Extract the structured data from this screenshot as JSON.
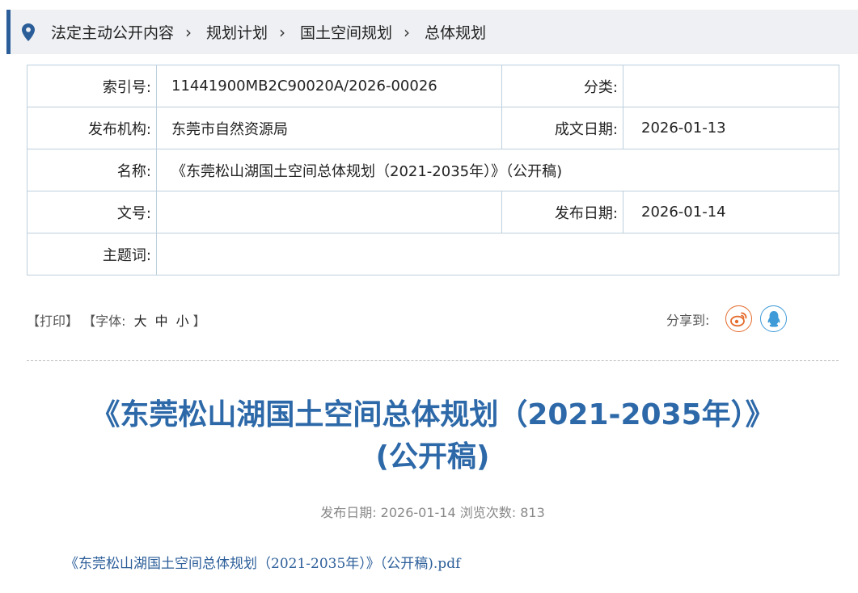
{
  "breadcrumb": {
    "items": [
      "法定主动公开内容",
      "规划计划",
      "国土空间规划",
      "总体规划"
    ]
  },
  "info": {
    "index_label": "索引号:",
    "index_value": "11441900MB2C90020A/2026-00026",
    "category_label": "分类:",
    "category_value": "",
    "publisher_label": "发布机构:",
    "publisher_value": "东莞市自然资源局",
    "doc_date_label": "成文日期:",
    "doc_date_value": "2026-01-13",
    "name_label": "名称:",
    "name_value": "《东莞松山湖国土空间总体规划（2021-2035年）》（公开稿)",
    "doc_no_label": "文号:",
    "doc_no_value": "",
    "pub_date_label": "发布日期:",
    "pub_date_value": "2026-01-14",
    "keywords_label": "主题词:",
    "keywords_value": ""
  },
  "tools": {
    "print": "【打印】",
    "font_prefix": "【字体: ",
    "font_large": "大",
    "font_medium": "中",
    "font_small": "小",
    "font_suffix": "】"
  },
  "share": {
    "label": "分享到:",
    "icons": [
      "weibo-icon",
      "qq-icon"
    ],
    "weibo_color": "#e46b2c",
    "qq_color": "#3e9bd8"
  },
  "article": {
    "title_line1": "《东莞松山湖国土空间总体规划（2021-2035年）》",
    "title_line2": "(公开稿)",
    "meta": "发布日期: 2026-01-14  浏览次数: 813",
    "attachment": "《东莞松山湖国土空间总体规划（2021-2035年）》（公开稿).pdf"
  },
  "colors": {
    "accent": "#2b5e99",
    "title": "#2d69a8",
    "link": "#2d5f9a"
  }
}
